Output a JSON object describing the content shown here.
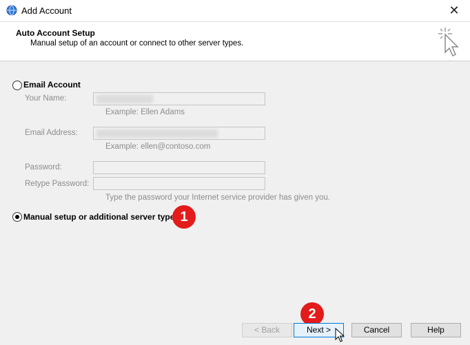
{
  "window": {
    "title": "Add Account",
    "close_glyph": "✕"
  },
  "header": {
    "title": "Auto Account Setup",
    "subtitle": "Manual setup of an account or connect to other server types."
  },
  "email_option": {
    "label": "Email Account",
    "selected": false
  },
  "fields": {
    "your_name": {
      "label": "Your Name:",
      "example": "Example: Ellen Adams"
    },
    "email_address": {
      "label": "Email Address:",
      "example": "Example: ellen@contoso.com"
    },
    "password": {
      "label": "Password:"
    },
    "retype_password": {
      "label": "Retype Password:",
      "hint": "Type the password your Internet service provider has given you."
    }
  },
  "manual_option": {
    "label": "Manual setup or additional server types",
    "selected": true
  },
  "annotations": {
    "step1": "1",
    "step2": "2"
  },
  "buttons": {
    "back": "< Back",
    "next": "Next >",
    "cancel": "Cancel",
    "help": "Help"
  },
  "colors": {
    "badge": "#e41b1b",
    "default_button_border": "#0078d7"
  },
  "icons": {
    "app": "outlook-globe-icon",
    "wizard": "cursor-sparkle-icon",
    "close": "close-icon"
  }
}
